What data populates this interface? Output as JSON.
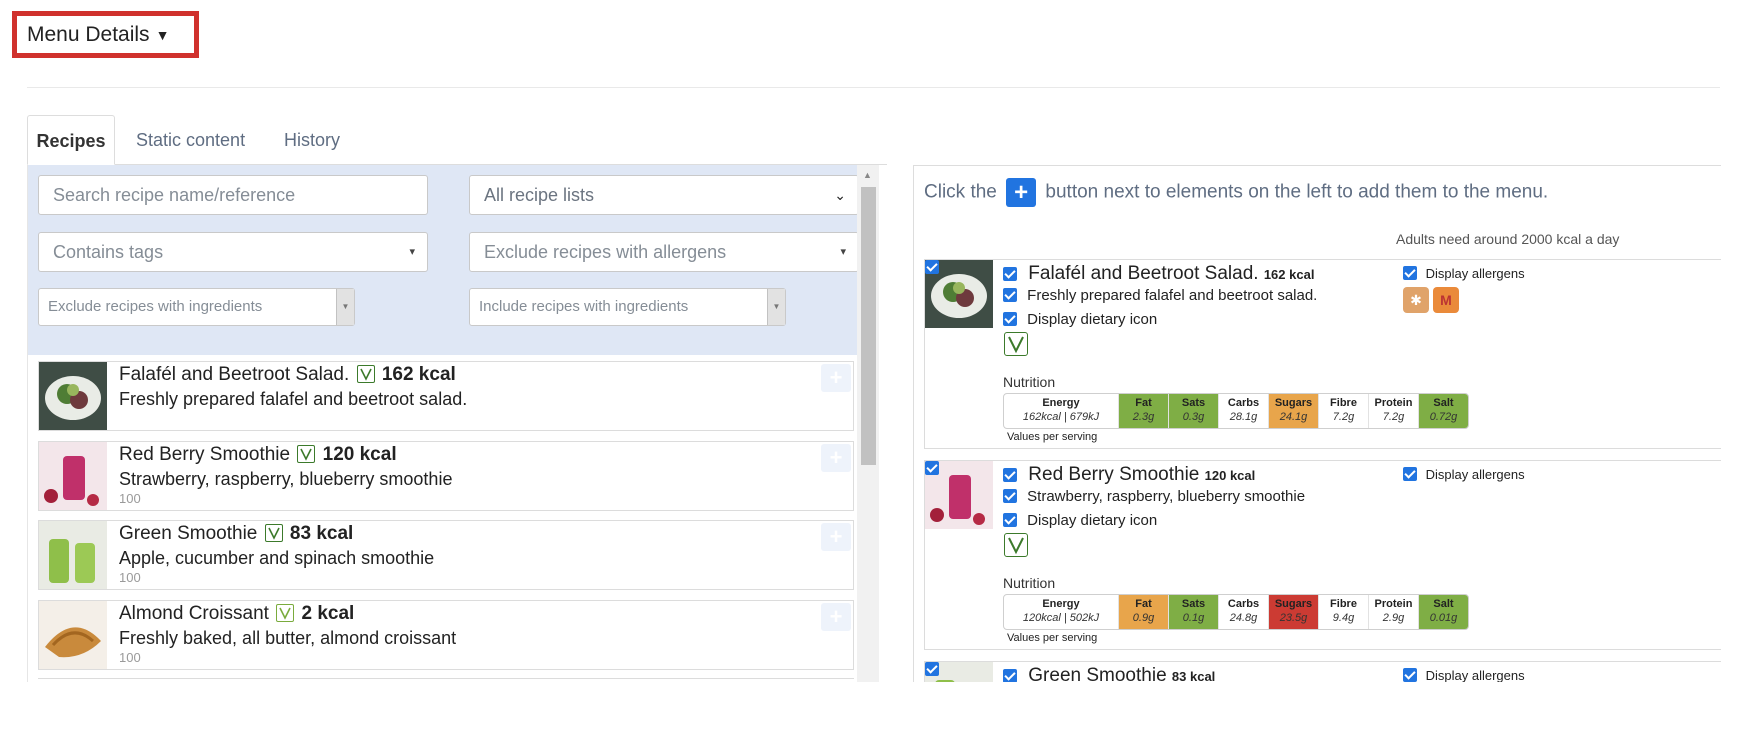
{
  "header": {
    "menu_details_label": "Menu Details"
  },
  "tabs": [
    {
      "label": "Recipes",
      "active": true
    },
    {
      "label": "Static content",
      "active": false
    },
    {
      "label": "History",
      "active": false
    }
  ],
  "filters": {
    "search_placeholder": "Search recipe name/reference",
    "recipe_lists_value": "All recipe lists",
    "tags_placeholder": "Contains tags",
    "allergens_placeholder": "Exclude recipes with allergens",
    "exclude_ingredients_placeholder": "Exclude recipes with ingredients",
    "include_ingredients_placeholder": "Include recipes with ingredients"
  },
  "recipes": [
    {
      "title": "Falafél and Beetroot Salad.",
      "kcal": "162 kcal",
      "desc": "Freshly prepared falafel and beetroot salad.",
      "ref": ""
    },
    {
      "title": "Red Berry Smoothie",
      "kcal": "120 kcal",
      "desc": "Strawberry, raspberry, blueberry smoothie",
      "ref": "100"
    },
    {
      "title": "Green Smoothie",
      "kcal": "83 kcal",
      "desc": "Apple, cucumber and spinach smoothie",
      "ref": "100"
    },
    {
      "title": "Almond Croissant",
      "kcal": "2 kcal",
      "desc": "Freshly baked, all butter, almond croissant",
      "ref": "100"
    }
  ],
  "right": {
    "instruction_before": "Click the",
    "instruction_after": "button next to elements on the left to add them to the menu.",
    "adults_note": "Adults need around 2000 kcal a day",
    "display_dietary_icon_label": "Display dietary icon",
    "display_allergens_label": "Display allergens",
    "nutrition_label": "Nutrition",
    "values_per_serving": "Values per serving",
    "energy_label": "Energy"
  },
  "menu_items": [
    {
      "title": "Falafél and Beetroot Salad.",
      "kcal": "162 kcal",
      "desc": "Freshly prepared falafel and beetroot salad.",
      "energy": "162kcal | 679kJ",
      "nutrients": [
        {
          "name": "Fat",
          "value": "2.3g",
          "color": "#7fae45"
        },
        {
          "name": "Sats",
          "value": "0.3g",
          "color": "#7fae45"
        },
        {
          "name": "Carbs",
          "value": "28.1g",
          "color": "#ffffff"
        },
        {
          "name": "Sugars",
          "value": "24.1g",
          "color": "#e8a54b"
        },
        {
          "name": "Fibre",
          "value": "7.2g",
          "color": "#ffffff"
        },
        {
          "name": "Protein",
          "value": "7.2g",
          "color": "#ffffff"
        },
        {
          "name": "Salt",
          "value": "0.72g",
          "color": "#7fae45"
        }
      ],
      "allergen_icons": [
        "gluten-icon",
        "milk-icon"
      ]
    },
    {
      "title": "Red Berry Smoothie",
      "kcal": "120 kcal",
      "desc": "Strawberry, raspberry, blueberry smoothie",
      "energy": "120kcal | 502kJ",
      "nutrients": [
        {
          "name": "Fat",
          "value": "0.9g",
          "color": "#e8a54b"
        },
        {
          "name": "Sats",
          "value": "0.1g",
          "color": "#7fae45"
        },
        {
          "name": "Carbs",
          "value": "24.8g",
          "color": "#ffffff"
        },
        {
          "name": "Sugars",
          "value": "23.5g",
          "color": "#cc3b33"
        },
        {
          "name": "Fibre",
          "value": "9.4g",
          "color": "#ffffff"
        },
        {
          "name": "Protein",
          "value": "2.9g",
          "color": "#ffffff"
        },
        {
          "name": "Salt",
          "value": "0.01g",
          "color": "#7fae45"
        }
      ],
      "allergen_icons": []
    },
    {
      "title": "Green Smoothie",
      "kcal": "83 kcal",
      "desc": "",
      "energy": "",
      "nutrients": [],
      "allergen_icons": []
    }
  ]
}
